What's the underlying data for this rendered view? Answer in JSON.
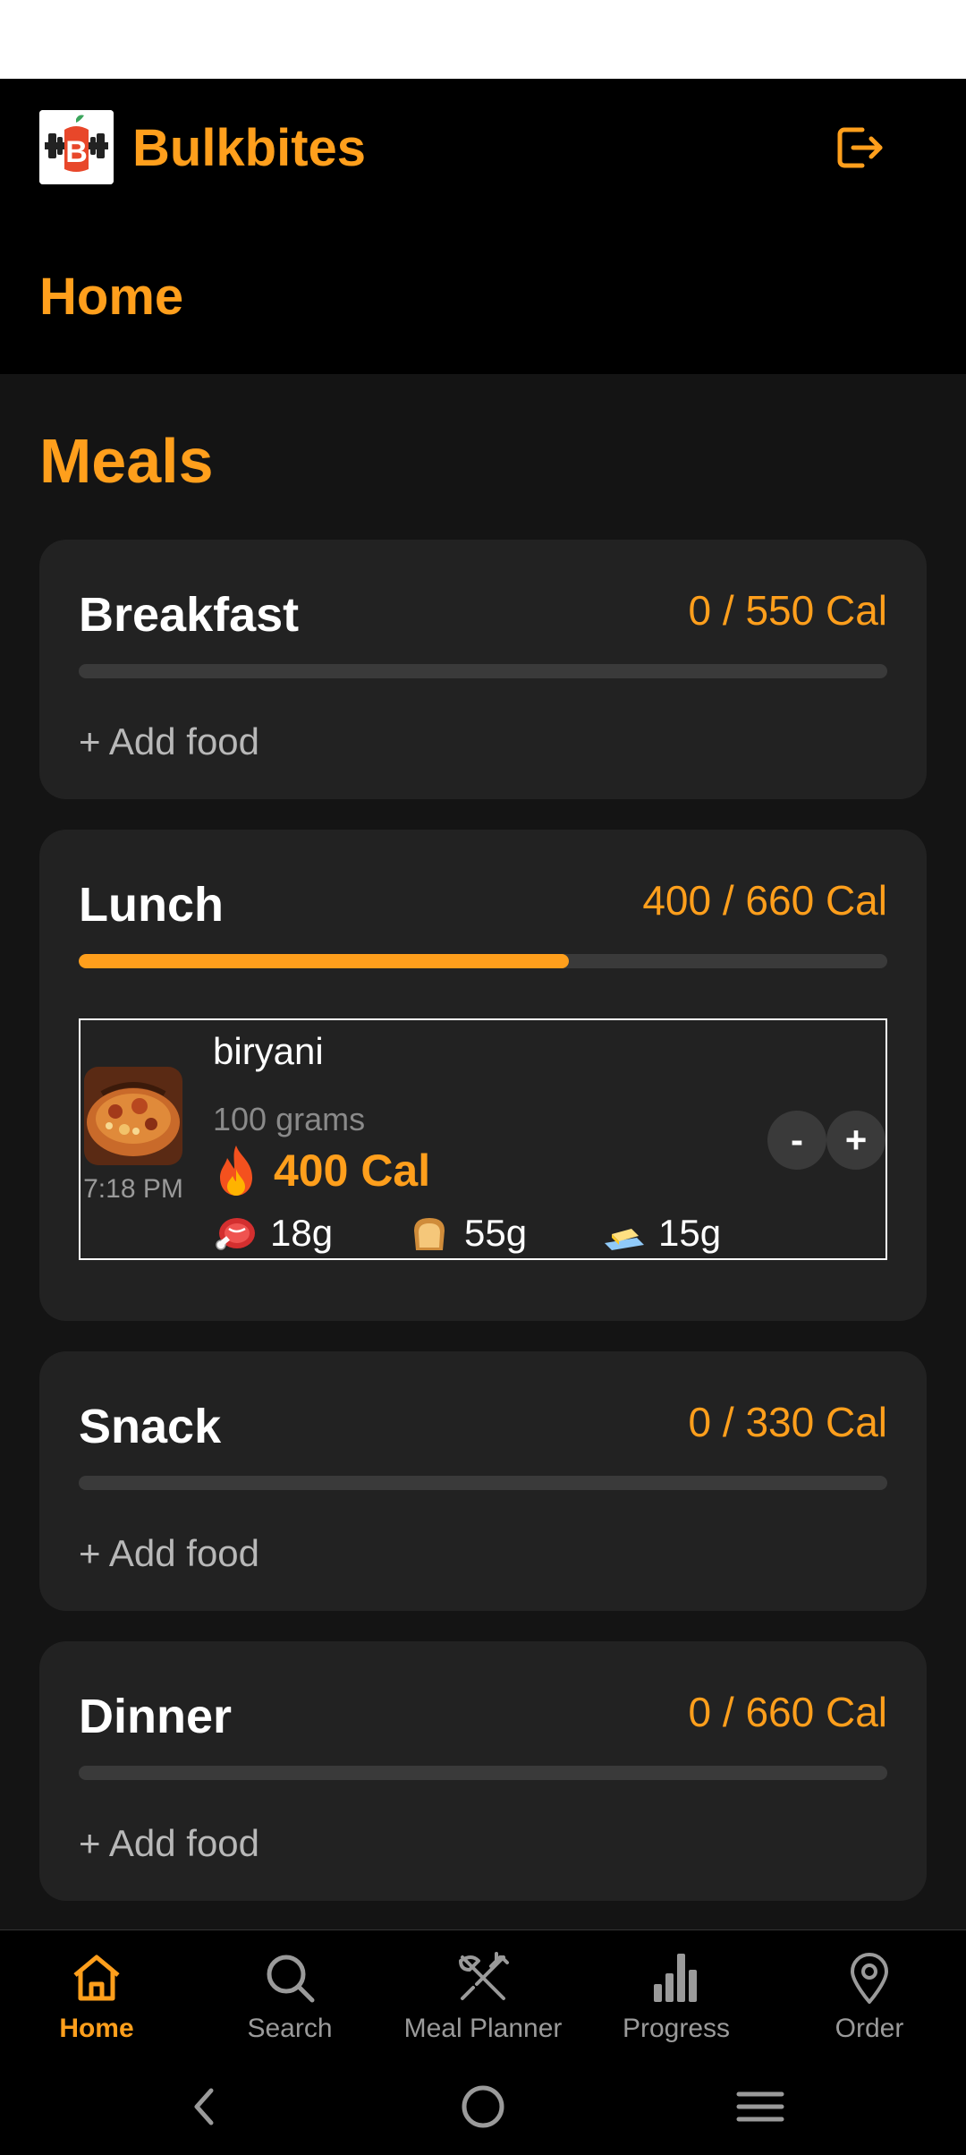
{
  "app": {
    "name": "Bulkbites",
    "logo_letter": "B",
    "page_title": "Home"
  },
  "icons": {
    "logo": "bulkbites-logo",
    "logout": "logout-icon",
    "calories": "flame-icon",
    "protein": "meat-icon",
    "carbs": "bread-icon",
    "fat": "butter-icon"
  },
  "colors": {
    "accent": "#FF9F1C",
    "card": "#222222",
    "background": "#141414",
    "header": "#000000"
  },
  "meals": {
    "title": "Meals",
    "breakfast": {
      "name": "Breakfast",
      "calories": "0 / 550 Cal",
      "progress": 0,
      "add_label": "+ Add food"
    },
    "lunch": {
      "name": "Lunch",
      "calories": "400 / 660 Cal",
      "progress": 0.606,
      "items": [
        {
          "name": "biryani",
          "time": "7:18 PM",
          "quantity": "100 grams",
          "calories": "400 Cal",
          "protein": "18g",
          "carbs": "55g",
          "fat": "15g",
          "decrement_label": "-",
          "increment_label": "+"
        }
      ]
    },
    "snack": {
      "name": "Snack",
      "calories": "0 / 330 Cal",
      "progress": 0,
      "add_label": "+ Add food"
    },
    "dinner": {
      "name": "Dinner",
      "calories": "0 / 660 Cal",
      "progress": 0,
      "add_label": "+ Add food"
    }
  },
  "bottom_nav": {
    "active": "home",
    "items": [
      {
        "label": "Home",
        "icon": "home-icon"
      },
      {
        "label": "Search",
        "icon": "search-icon"
      },
      {
        "label": "Meal Planner",
        "icon": "utensils-icon"
      },
      {
        "label": "Progress",
        "icon": "bar-chart-icon"
      },
      {
        "label": "Order",
        "icon": "location-pin-icon"
      }
    ]
  },
  "system_nav": {
    "buttons": [
      "back-icon",
      "home-circle-icon",
      "recents-icon"
    ]
  }
}
